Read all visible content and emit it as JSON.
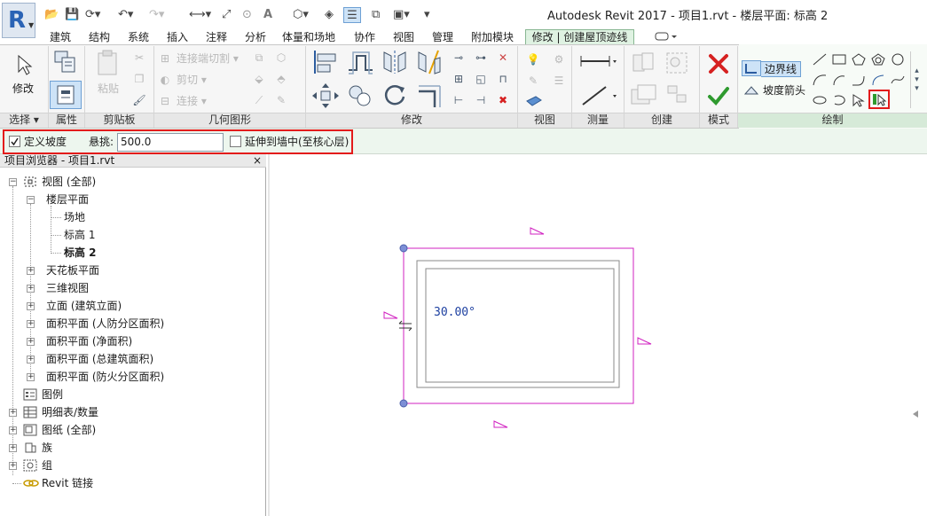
{
  "app": {
    "logo_letter": "R",
    "title": "Autodesk Revit 2017 -     项目1.rvt - 楼层平面: 标高 2"
  },
  "tabs": [
    "建筑",
    "结构",
    "系统",
    "插入",
    "注释",
    "分析",
    "体量和场地",
    "协作",
    "视图",
    "管理",
    "附加模块"
  ],
  "active_tab": "修改 | 创建屋顶迹线",
  "ribbon": {
    "select": {
      "modify_label": "修改",
      "group_label": "选择 ▾"
    },
    "properties": {
      "group_label": "属性"
    },
    "clipboard": {
      "paste_label": "粘贴",
      "group_label": "剪贴板"
    },
    "geometry": {
      "cope_label": "连接端切割 ▾",
      "cut_label": "剪切 ▾",
      "join_label": "连接 ▾",
      "group_label": "几何图形"
    },
    "modify": {
      "group_label": "修改"
    },
    "view": {
      "group_label": "视图"
    },
    "measure": {
      "group_label": "测量"
    },
    "create": {
      "group_label": "创建"
    },
    "mode": {
      "group_label": "模式"
    },
    "draw": {
      "boundary_line_label": "边界线",
      "slope_arrow_label": "坡度箭头",
      "group_label": "绘制"
    }
  },
  "options_bar": {
    "define_slope_label": "定义坡度",
    "define_slope_checked": true,
    "overhang_label": "悬挑:",
    "overhang_value": "500.0",
    "extend_label": "延伸到墙中(至核心层)",
    "extend_checked": false
  },
  "project_browser": {
    "title": "项目浏览器 - 项目1.rvt",
    "close_label": "×",
    "tree": {
      "views": "视图 (全部)",
      "floor_plans": "楼层平面",
      "site": "场地",
      "level1": "标高 1",
      "level2": "标高 2",
      "ceiling": "天花板平面",
      "threed": "三维视图",
      "elevations": "立面 (建筑立面)",
      "area1": "面积平面 (人防分区面积)",
      "area2": "面积平面 (净面积)",
      "area3": "面积平面 (总建筑面积)",
      "area4": "面积平面 (防火分区面积)",
      "legends": "图例",
      "schedules": "明细表/数量",
      "sheets": "图纸 (全部)",
      "families": "族",
      "groups": "组",
      "links": "Revit 链接"
    }
  },
  "canvas": {
    "slope_angle": "30.00°"
  },
  "colors": {
    "sketch_line": "#d020c0",
    "wall": "#7f7f7f",
    "highlight": "#e31b1b",
    "active_tab_bg": "#dff2e2",
    "options_bg": "#edf6ee"
  }
}
